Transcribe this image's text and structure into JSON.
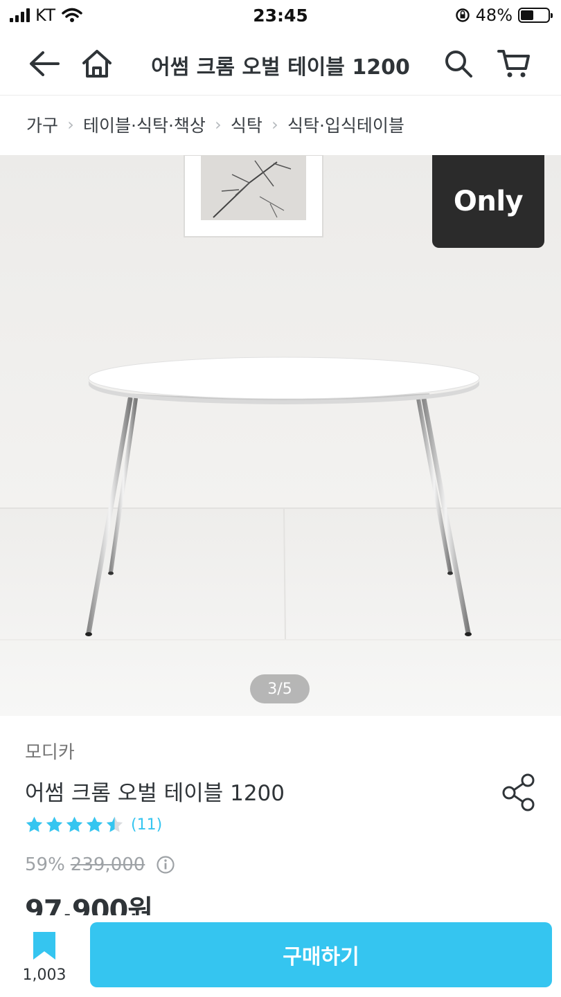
{
  "status_bar": {
    "carrier": "KT",
    "time": "23:45",
    "battery": "48%",
    "battery_level": 0.48
  },
  "header": {
    "title": "어썸 크롬 오벌 테이블 1200",
    "back_icon": "arrow-left-icon",
    "home_icon": "home-icon",
    "search_icon": "search-icon",
    "cart_icon": "cart-icon"
  },
  "breadcrumb": [
    "가구",
    "테이블·식탁·책상",
    "식탁",
    "식탁·입식테이블"
  ],
  "gallery": {
    "badge": "Only",
    "indicator": "3/5"
  },
  "product": {
    "brand": "모디카",
    "name": "어썸 크롬 오벌 테이블 1200",
    "rating": 4.5,
    "review_count": "(11)",
    "discount_rate": "59%",
    "original_price": "239,000",
    "sale_price": "97,900원"
  },
  "bottom_bar": {
    "bookmark_count": "1,003",
    "buy_label": "구매하기"
  },
  "colors": {
    "accent": "#35c5f0",
    "text": "#2f3438",
    "muted": "#9ea2a6",
    "badge": "#2b2b2b"
  }
}
